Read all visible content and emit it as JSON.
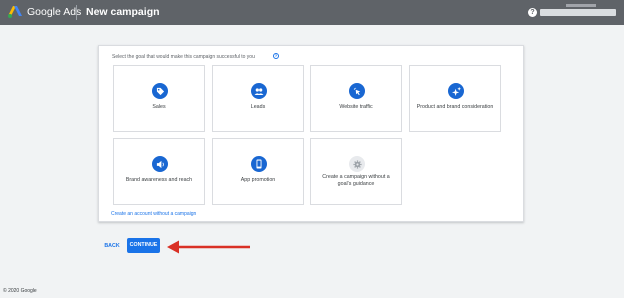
{
  "header": {
    "brand": "Google Ads",
    "title": "New campaign",
    "help_icon": "help-icon"
  },
  "goal_panel": {
    "prompt": "Select the goal that would make this campaign successful to you",
    "goals": [
      {
        "label": "Sales",
        "icon": "tag-icon"
      },
      {
        "label": "Leads",
        "icon": "people-icon"
      },
      {
        "label": "Website traffic",
        "icon": "cursor-click-icon"
      },
      {
        "label": "Product and brand consideration",
        "icon": "sparkle-icon"
      },
      {
        "label": "Brand awareness and reach",
        "icon": "speaker-icon"
      },
      {
        "label": "App promotion",
        "icon": "phone-icon"
      },
      {
        "label": "Create a campaign without a goal's guidance",
        "icon": "gear-icon"
      }
    ],
    "create_account_link": "Create an account without a campaign"
  },
  "actions": {
    "back": "BACK",
    "continue": "CONTINUE"
  },
  "footer": {
    "copyright": "© 2020 Google"
  },
  "colors": {
    "topbar": "#5f6368",
    "accent": "#1a73e8",
    "icon_fill": "#1967d2",
    "annotation_arrow": "#d93025"
  }
}
